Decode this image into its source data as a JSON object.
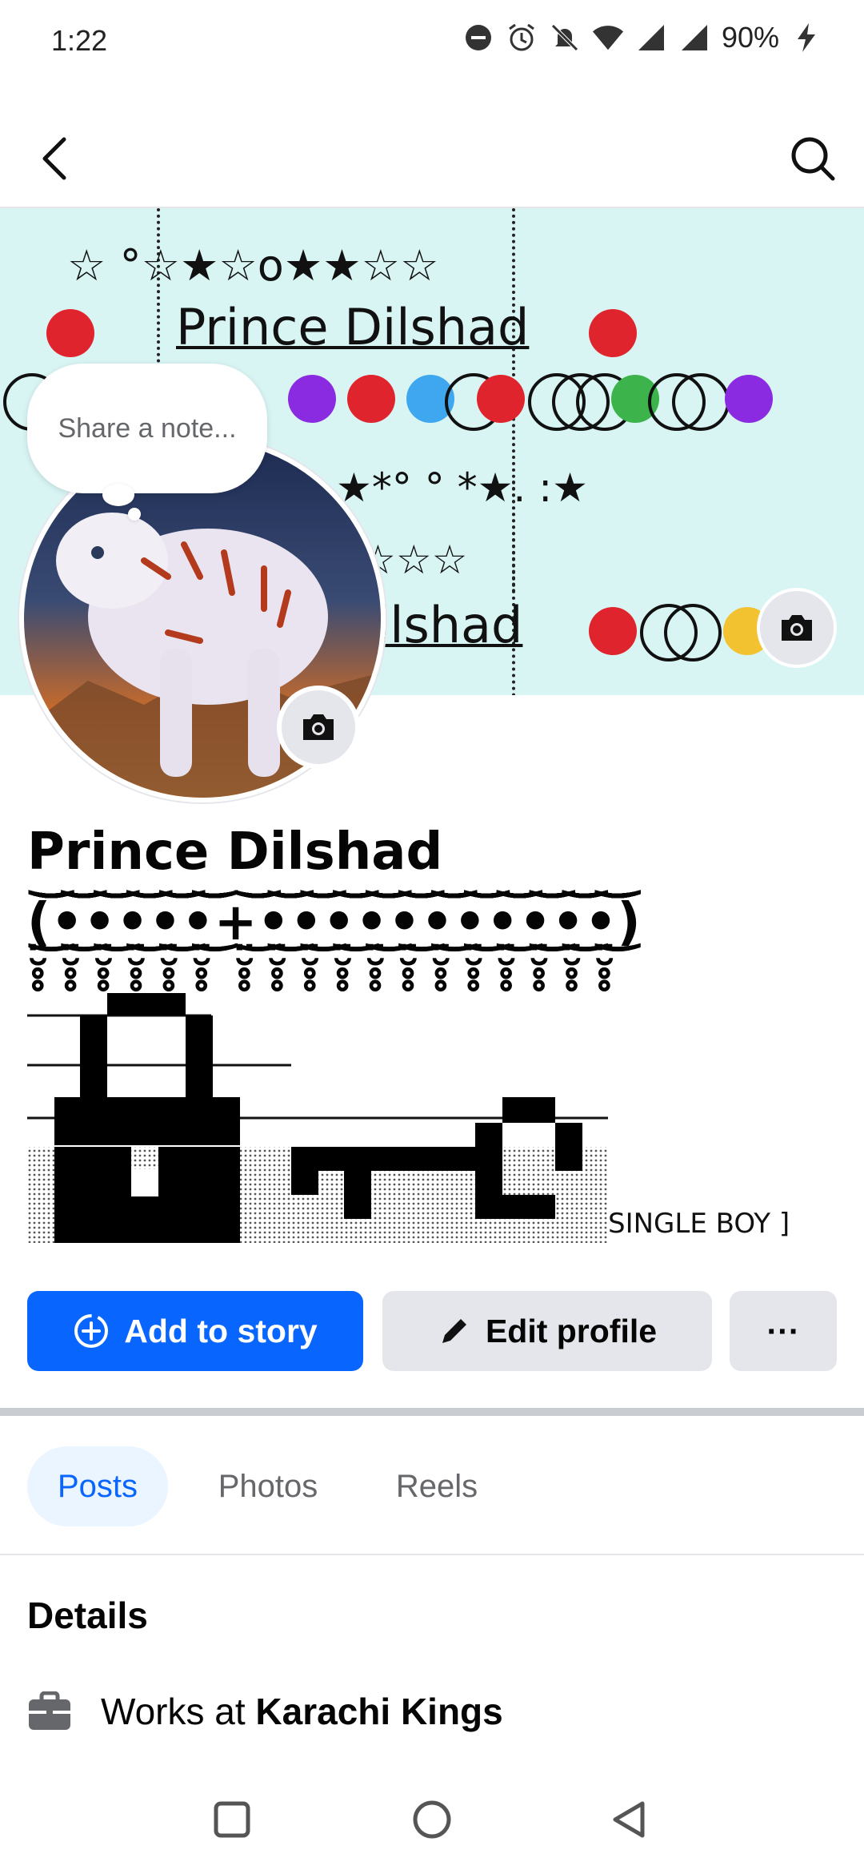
{
  "status_bar": {
    "time": "1:22",
    "battery": "90%",
    "icons": [
      "do-not-disturb-icon",
      "alarm-icon",
      "silent-icon",
      "wifi-icon",
      "signal-icon",
      "signal-icon",
      "battery-charging-icon"
    ]
  },
  "nav": {
    "back_icon": "chevron-left-icon",
    "search_icon": "search-icon"
  },
  "cover": {
    "text_name": "Prince Dilshad",
    "text_name_2": "ilshad",
    "stars_row_1": "☆ °☆★☆o★★☆☆",
    "stars_row_2": "★*° ° *★. :★",
    "stars_row_3": "☆☆☆",
    "camera_icon": "camera-icon"
  },
  "note": {
    "placeholder": "Share a note..."
  },
  "profile": {
    "camera_icon": "camera-icon",
    "name": "Prince Dilshad (̤̮̥̥͜͜͝͝͝͝͝͝͝͝•̤̮̥̥͜͜͝͝͝͝͝͝͝͝•̤̮̥̥͜͜͝͝͝͝͝͝͝͝•̤̮̥̥͜͜͝͝͝͝͝͝͝͝•̤̮̥̥͜͜͝͝͝͝͝͝͝͝•̤̮̥̥͜͜͝͝͝͝͝͝͝͝+̤̮̥̥͜͜͝͝͝͝͝͝͝͝•̤̮̥̥͜͜͝͝͝͝͝͝͝͝•̤̮̥̥͜͜͝͝͝͝͝͝͝͝•̤̮̥̥͜͜͝͝͝͝͝͝͝͝•̤̮̥̥͜͜͝͝͝͝͝͝͝͝•̤̮̥̥͜͜͝͝͝͝͝͝͝͝•̤̮̥̥͜͜͝͝͝͝͝͝͝͝•̤̮̥̥͜͜͝͝͝͝͝͝͝͝•̤̮̥̥͜͜͝͝͝͝͝͝͝͝•̤̮̥̥͜͜͝͝͝͝͝͝͝͝•̤̮̥̥͜͜͝͝͝͝͝͝͝͝•̤̮̥̥͜͜͝͝͝͝͝͝͝͝)",
    "bio_suffix": "SINGLE BOY ]"
  },
  "actions": {
    "add_to_story": "Add to story",
    "add_to_story_icon": "plus-circle-icon",
    "edit_profile": "Edit profile",
    "edit_profile_icon": "pencil-icon",
    "more": "···"
  },
  "tabs": [
    {
      "label": "Posts",
      "active": true
    },
    {
      "label": "Photos",
      "active": false
    },
    {
      "label": "Reels",
      "active": false
    }
  ],
  "details": {
    "heading": "Details",
    "work_prefix": "Works at ",
    "work_employer": "Karachi Kings",
    "work_icon": "briefcase-icon"
  },
  "system_nav": {
    "recents_icon": "square-icon",
    "home_icon": "circle-icon",
    "back_icon": "triangle-back-icon"
  },
  "colors": {
    "primary": "#0866ff",
    "button_grey": "#e4e6eb",
    "tab_active_bg": "#ebf5ff",
    "cover_bg": "#d8f4f3"
  }
}
